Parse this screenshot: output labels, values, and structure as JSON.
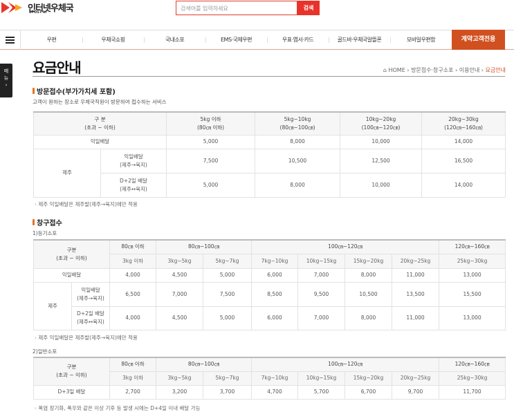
{
  "header": {
    "logo_name": "인터넷우체국",
    "logo_sub": "ePOST kr",
    "search_placeholder": "검색어를 입력하세요",
    "search_button": "검색"
  },
  "nav": {
    "items": [
      "우편",
      "우체국쇼핑",
      "국내소포",
      "EMS·국제우편",
      "우표·엽서·카드",
      "골드바·우체국알뜰폰",
      "모바일우편함"
    ],
    "cta": "계약고객전용"
  },
  "sidemenu": {
    "label1": "메",
    "label2": "뉴",
    "arrow": "›"
  },
  "page": {
    "title": "요금안내",
    "breadcrumb": [
      "HOME",
      "방문접수·창구소포",
      "이용안내",
      "요금안내"
    ]
  },
  "visit": {
    "heading": "방문접수(부가가치세 포함)",
    "desc": "고객이 원하는 장소로 우체국직원이 방문하여 접수하는 서비스",
    "head": {
      "label1": "구 분",
      "label2": "(초과 ~ 이하)",
      "cols": [
        [
          "5kg 이하",
          "(80㎝ 이하)"
        ],
        [
          "5kg~10kg",
          "(80㎝~100㎝)"
        ],
        [
          "10kg~20kg",
          "(100㎝~120㎝)"
        ],
        [
          "20kg~30kg",
          "(120㎝~160㎝)"
        ]
      ]
    },
    "rows": {
      "next": {
        "label": "익일배달",
        "values": [
          "5,000",
          "8,000",
          "10,000",
          "14,000"
        ]
      },
      "jeju": "제주",
      "jeju_next": {
        "label1": "익일배달",
        "label2": "(제주→육지)",
        "values": [
          "7,500",
          "10,500",
          "12,500",
          "16,500"
        ]
      },
      "jeju_d2": {
        "label1": "D+2일 배달",
        "label2": "(제주↔육지)",
        "values": [
          "5,000",
          "8,000",
          "10,000",
          "14,000"
        ]
      }
    },
    "note": "제주 익일배달은 제주발(제주→육지)에만 적용"
  },
  "counter": {
    "heading": "창구접수",
    "reg": {
      "subtitle": "1)등기소포",
      "label1": "구분",
      "label2": "(초과 ~ 이하)",
      "groups": [
        "80㎝ 이하",
        "80㎝~100㎝",
        "100㎝~120㎝",
        "120㎝~160㎝"
      ],
      "weights": [
        "3kg 이하",
        "3kg~5kg",
        "5kg~7kg",
        "7kg~10kg",
        "10kg~15kg",
        "15kg~20kg",
        "20kg~25kg",
        "25kg~30kg"
      ],
      "next": {
        "label": "익일배달",
        "values": [
          "4,000",
          "4,500",
          "5,000",
          "6,000",
          "7,000",
          "8,000",
          "11,000",
          "13,000"
        ]
      },
      "jeju": "제주",
      "jeju_next": {
        "label1": "익일배달",
        "label2": "(제주→육지)",
        "values": [
          "6,500",
          "7,000",
          "7,500",
          "8,500",
          "9,500",
          "10,500",
          "13,500",
          "15,500"
        ]
      },
      "jeju_d2": {
        "label1": "D+2일 배달",
        "label2": "(제주↔육지)",
        "values": [
          "4,000",
          "4,500",
          "5,000",
          "6,000",
          "7,000",
          "8,000",
          "11,000",
          "13,000"
        ]
      },
      "note": "제주 익일배달은 제주발(제주→육지)에만 적용"
    },
    "normal": {
      "subtitle": "2)일반소포",
      "label1": "구분",
      "label2": "(초과 ~ 이하)",
      "groups": [
        "80㎝ 이하",
        "80㎝~100㎝",
        "100㎝~120㎝",
        "120㎝~160㎝"
      ],
      "weights": [
        "3kg 이하",
        "3kg~5kg",
        "5kg~7kg",
        "7kg~10kg",
        "10kg~15kg",
        "15kg~20kg",
        "20kg~25kg",
        "25kg~30kg"
      ],
      "d3": {
        "label": "D+3일 배달",
        "values": [
          "2,700",
          "3,200",
          "3,700",
          "4,700",
          "5,700",
          "6,700",
          "9,700",
          "11,700"
        ]
      },
      "note": "폭염 장기화, 폭우와 같은 이상 기후 등 발생 시에는 D+4일 이내 배달 가능"
    }
  },
  "colors": {
    "accent": "#d1501f",
    "search_red": "#e8332a"
  }
}
